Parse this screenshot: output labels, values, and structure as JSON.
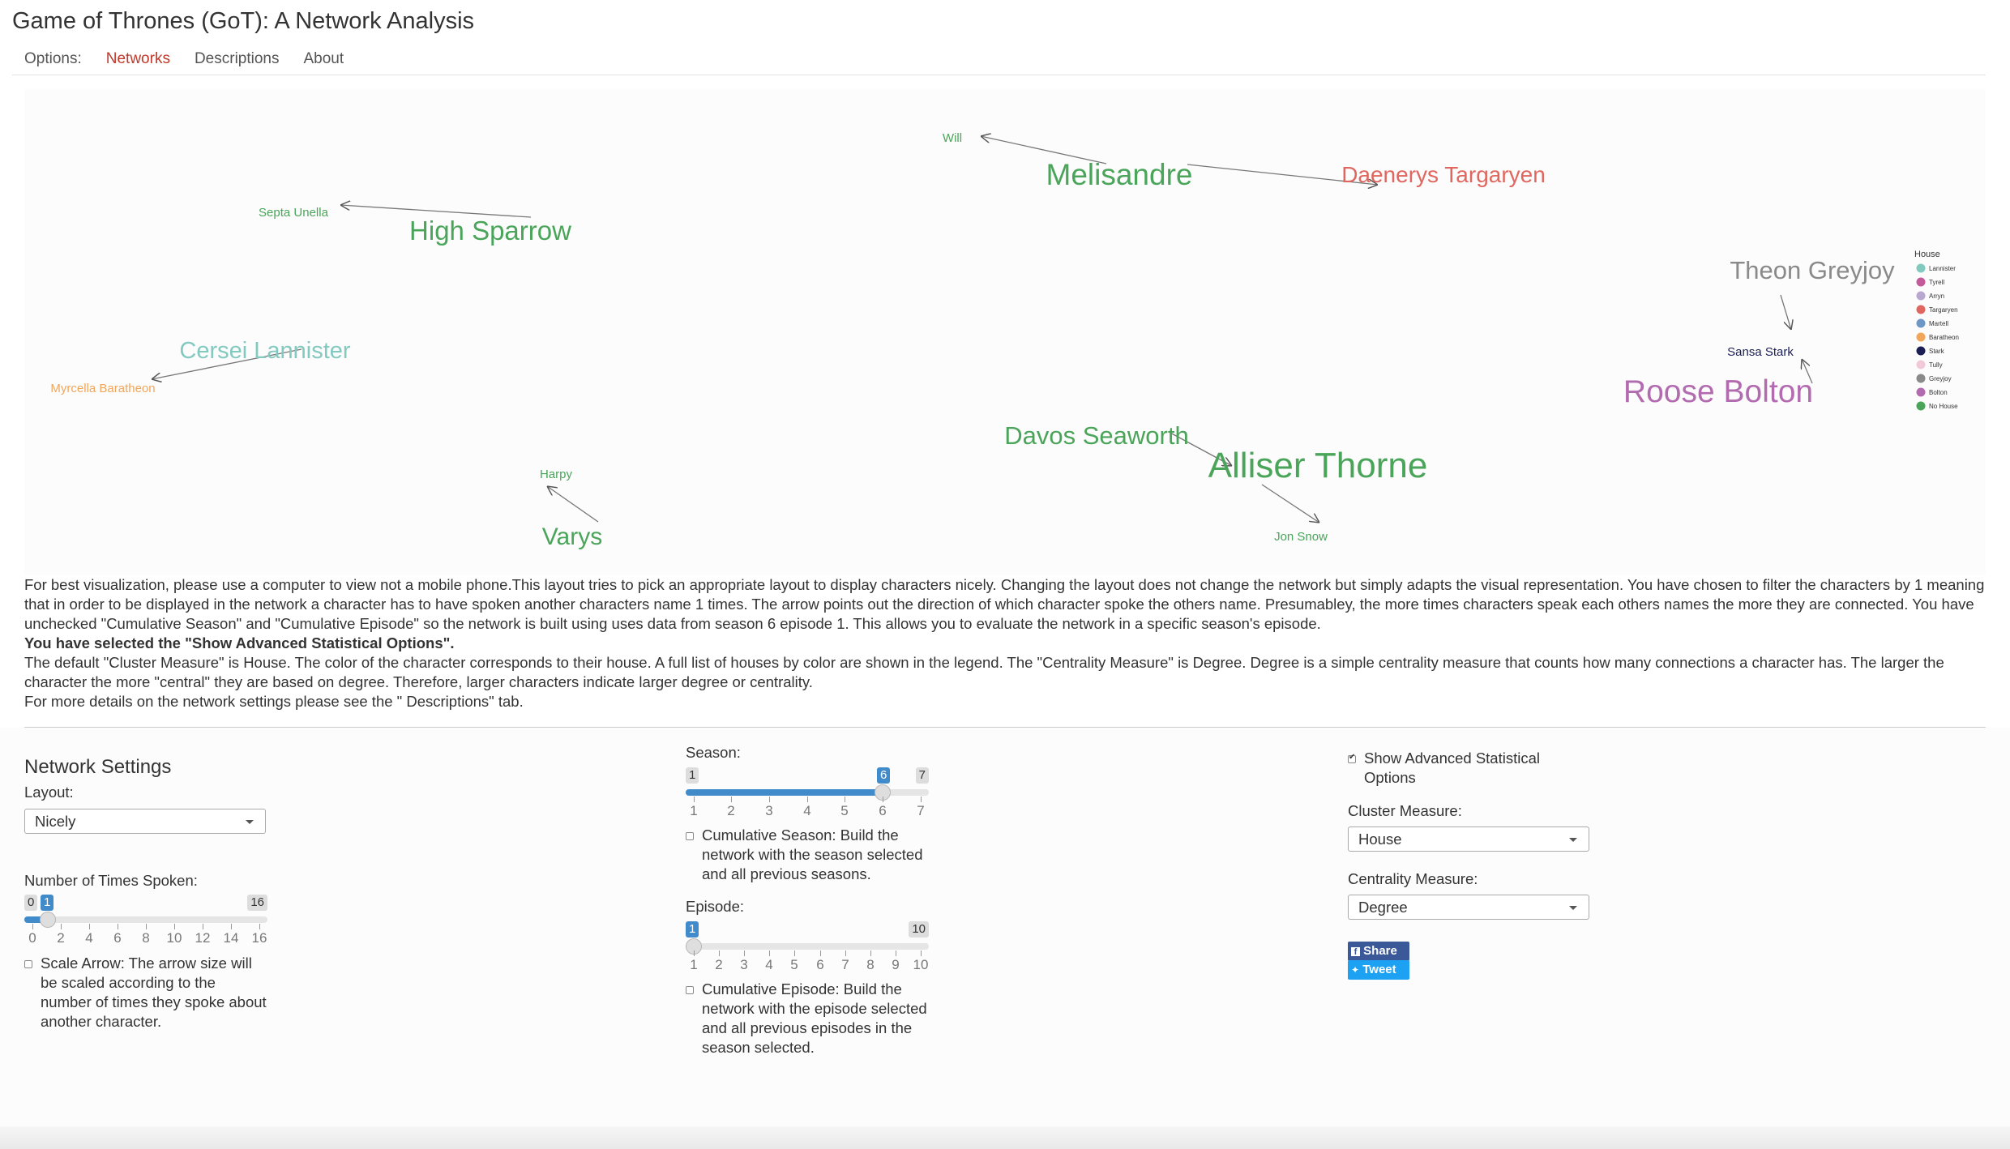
{
  "app": {
    "title": "Game of Thrones (GoT): A Network Analysis"
  },
  "nav": {
    "brand": "Options:",
    "tabs": [
      {
        "label": "Networks",
        "active": true
      },
      {
        "label": "Descriptions",
        "active": false
      },
      {
        "label": "About",
        "active": false
      }
    ]
  },
  "network": {
    "nodes": [
      {
        "id": "will",
        "label": "Will",
        "color": "#4aa55a",
        "size": "small"
      },
      {
        "id": "melisandre",
        "label": "Melisandre",
        "color": "#4aa55a",
        "size": "large"
      },
      {
        "id": "daenerys",
        "label": "Daenerys Targaryen",
        "color": "#e0675f",
        "size": "medium"
      },
      {
        "id": "septa-unella",
        "label": "Septa Unella",
        "color": "#4aa55a",
        "size": "small"
      },
      {
        "id": "high-sparrow",
        "label": "High Sparrow",
        "color": "#4aa55a",
        "size": "large"
      },
      {
        "id": "theon",
        "label": "Theon Greyjoy",
        "color": "#8a8a8a",
        "size": "medium"
      },
      {
        "id": "sansa",
        "label": "Sansa Stark",
        "color": "#1b1f56",
        "size": "small"
      },
      {
        "id": "roose",
        "label": "Roose Bolton",
        "color": "#b36bb0",
        "size": "large"
      },
      {
        "id": "cersei",
        "label": "Cersei Lannister",
        "color": "#82c9c0",
        "size": "medium"
      },
      {
        "id": "myrcella",
        "label": "Myrcella Baratheon",
        "color": "#f2a65a",
        "size": "small"
      },
      {
        "id": "davos",
        "label": "Davos Seaworth",
        "color": "#4aa55a",
        "size": "medium"
      },
      {
        "id": "alliser",
        "label": "Alliser Thorne",
        "color": "#4aa55a",
        "size": "large"
      },
      {
        "id": "harpy",
        "label": "Harpy",
        "color": "#4aa55a",
        "size": "small"
      },
      {
        "id": "varys",
        "label": "Varys",
        "color": "#4aa55a",
        "size": "medium"
      },
      {
        "id": "jon",
        "label": "Jon Snow",
        "color": "#4aa55a",
        "size": "small"
      }
    ],
    "edges": [
      {
        "from": "melisandre",
        "to": "will"
      },
      {
        "from": "melisandre",
        "to": "daenerys"
      },
      {
        "from": "high-sparrow",
        "to": "septa-unella"
      },
      {
        "from": "theon",
        "to": "sansa"
      },
      {
        "from": "roose",
        "to": "sansa"
      },
      {
        "from": "cersei",
        "to": "myrcella"
      },
      {
        "from": "davos",
        "to": "alliser"
      },
      {
        "from": "varys",
        "to": "harpy"
      },
      {
        "from": "alliser",
        "to": "jon"
      }
    ],
    "legend": {
      "title": "House",
      "items": [
        {
          "label": "Lannister",
          "color": "#82c9c0"
        },
        {
          "label": "Tyrell",
          "color": "#c45a9a"
        },
        {
          "label": "Arryn",
          "color": "#b9a7cf"
        },
        {
          "label": "Targaryen",
          "color": "#e0675f"
        },
        {
          "label": "Martell",
          "color": "#6d97c4"
        },
        {
          "label": "Baratheon",
          "color": "#f2a65a"
        },
        {
          "label": "Stark",
          "color": "#1b1f56"
        },
        {
          "label": "Tully",
          "color": "#f2c9d8"
        },
        {
          "label": "Greyjoy",
          "color": "#8a8a8a"
        },
        {
          "label": "Bolton",
          "color": "#b36bb0"
        },
        {
          "label": "No House",
          "color": "#4aa55a"
        }
      ]
    }
  },
  "description": {
    "line1": "For best visualization, please use a computer to view not a mobile phone.This layout tries to pick an appropriate layout to display characters nicely. Changing the layout does not change the network but simply adapts the visual representation. You have chosen to filter the characters by 1 meaning that in order to be displayed in the network a character has to have spoken another characters name 1 times. The arrow points out the direction of which character spoke the others name. Presumabley, the more times characters speak each others names the more they are connected. You have unchecked \"Cumulative Season\" and \"Cumulative Episode\" so the network is built using uses data from season 6 episode 1. This allows you to evaluate the network in a specific season's episode.",
    "advanced": "You have selected the \"Show Advanced Statistical Options\".",
    "line2": "The default \"Cluster Measure\" is House. The color of the character corresponds to their house. A full list of houses by color are shown in the legend. The \"Centrality Measure\" is Degree. Degree is a simple centrality measure that counts how many connections a character has. The larger the character the more \"central\" they are based on degree. Therefore, larger characters indicate larger degree or centrality.",
    "line3": "For more details on the network settings please see the \" Descriptions\" tab."
  },
  "settings": {
    "heading": "Network Settings",
    "layout_label": "Layout:",
    "layout_value": "Nicely",
    "times_label": "Number of Times Spoken:",
    "times_slider": {
      "min": 0,
      "max": 16,
      "value": 1,
      "min_label": "0",
      "max_label": "16",
      "value_label": "1",
      "ticks": [
        "0",
        "2",
        "4",
        "6",
        "8",
        "10",
        "12",
        "14",
        "16"
      ]
    },
    "scale_arrow_text": "Scale Arrow: The arrow size will be scaled according to the number of times they spoke about another character.",
    "season_label": "Season:",
    "season_slider": {
      "min": 1,
      "max": 7,
      "value": 6,
      "min_label": "1",
      "max_label": "7",
      "value_label": "6",
      "ticks": [
        "1",
        "2",
        "3",
        "4",
        "5",
        "6",
        "7"
      ]
    },
    "cum_season_text": "Cumulative Season: Build the network with the season selected and all previous seasons.",
    "episode_label": "Episode:",
    "episode_slider": {
      "min": 1,
      "max": 10,
      "value": 1,
      "min_label": "1",
      "max_label": "10",
      "value_label": "1",
      "ticks": [
        "1",
        "2",
        "3",
        "4",
        "5",
        "6",
        "7",
        "8",
        "9",
        "10"
      ]
    },
    "cum_episode_text": "Cumulative Episode: Build the network with the episode selected and all previous episodes in the season selected.",
    "advanced_label": "Show Advanced Statistical Options",
    "cluster_label": "Cluster Measure:",
    "cluster_value": "House",
    "centrality_label": "Centrality Measure:",
    "centrality_value": "Degree",
    "share_label": "Share",
    "tweet_label": "Tweet"
  }
}
